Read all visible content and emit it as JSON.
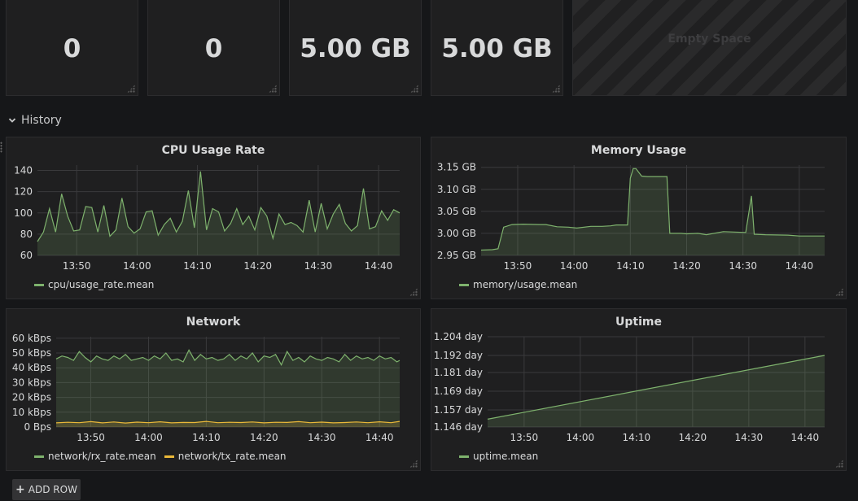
{
  "stats": [
    {
      "value": "0"
    },
    {
      "value": "0"
    },
    {
      "value": "5.00 GB"
    },
    {
      "value": "5.00 GB"
    }
  ],
  "empty_space": {
    "text": "Empty Space"
  },
  "row": {
    "title": "History"
  },
  "add_row": {
    "label": "ADD ROW"
  },
  "colors": {
    "green": "#7eb26d",
    "yellow": "#eab839"
  },
  "chart_data": [
    {
      "type": "line",
      "title": "CPU Usage Rate",
      "y_ticks": [
        "60",
        "80",
        "100",
        "120",
        "140"
      ],
      "ylim": [
        60,
        145
      ],
      "x_ticks": [
        "13:50",
        "14:00",
        "14:10",
        "14:20",
        "14:30",
        "14:40"
      ],
      "x_tick_minutes": [
        830,
        840,
        850,
        860,
        870,
        880
      ],
      "xlim": [
        823.5,
        883.5
      ],
      "series": [
        {
          "name": "cpu/usage_rate.mean",
          "color": "#7eb26d",
          "x": [
            823.5,
            824.5,
            825.5,
            826.5,
            827.5,
            828.5,
            829.5,
            830.5,
            831.5,
            832.5,
            833.5,
            834.5,
            835.5,
            836.5,
            837.5,
            838.5,
            839.5,
            840.5,
            841.5,
            842.5,
            843.5,
            844.5,
            845.5,
            846.5,
            847.5,
            848.5,
            849.5,
            850.5,
            851.5,
            852.5,
            853.5,
            854.5,
            855.5,
            856.5,
            857.5,
            858.5,
            859.5,
            860.5,
            861.5,
            862.5,
            863.5,
            864.5,
            865.5,
            866.5,
            867.5,
            868.5,
            869.5,
            870.5,
            871.5,
            872.5,
            873.5,
            874.5,
            875.5,
            876.5,
            877.5,
            878.5,
            879.5,
            880.5,
            881.5,
            882.5,
            883.5
          ],
          "y": [
            73,
            82,
            104,
            82,
            118,
            97,
            83,
            84,
            106,
            105,
            82,
            107,
            78,
            84,
            114,
            87,
            81,
            85,
            101,
            102,
            79,
            89,
            95,
            82,
            92,
            121,
            86,
            139,
            84,
            104,
            101,
            83,
            90,
            104,
            89,
            97,
            84,
            105,
            97,
            76,
            99,
            89,
            91,
            88,
            82,
            112,
            82,
            109,
            85,
            99,
            108,
            90,
            83,
            88,
            123,
            85,
            87,
            102,
            93,
            103,
            100
          ]
        }
      ]
    },
    {
      "type": "line",
      "title": "Memory Usage",
      "y_ticks": [
        "2.95 GB",
        "3.00 GB",
        "3.05 GB",
        "3.10 GB",
        "3.15 GB"
      ],
      "y_tick_values": [
        2.95,
        3.0,
        3.05,
        3.1,
        3.15
      ],
      "ylim": [
        2.95,
        3.155
      ],
      "x_ticks": [
        "13:50",
        "14:00",
        "14:10",
        "14:20",
        "14:30",
        "14:40"
      ],
      "x_tick_minutes": [
        830,
        840,
        850,
        860,
        870,
        880
      ],
      "xlim": [
        823.5,
        884.5
      ],
      "series": [
        {
          "name": "memory/usage.mean",
          "color": "#7eb26d",
          "x": [
            823.5,
            825.5,
            826.5,
            827.5,
            829,
            831,
            834,
            835,
            837,
            839,
            840.5,
            843,
            845,
            846.5,
            847.5,
            849.5,
            850,
            850.5,
            851,
            852,
            853,
            856.5,
            857,
            859,
            860,
            862,
            863.5,
            866.5,
            868.5,
            870.5,
            871.5,
            872,
            874,
            878,
            880,
            884.5
          ],
          "y": [
            2.962,
            2.963,
            2.965,
            3.014,
            3.02,
            3.021,
            3.02,
            3.02,
            3.015,
            3.014,
            3.012,
            3.016,
            3.016,
            3.017,
            3.019,
            3.019,
            3.125,
            3.147,
            3.147,
            3.13,
            3.129,
            3.129,
            3.0,
            3.0,
            2.999,
            3.0,
            2.997,
            3.004,
            3.003,
            3.002,
            3.085,
            2.998,
            2.997,
            2.996,
            2.994,
            2.994
          ]
        }
      ]
    },
    {
      "type": "line",
      "title": "Network",
      "y_ticks": [
        "0 Bps",
        "10 kBps",
        "20 kBps",
        "30 kBps",
        "40 kBps",
        "50 kBps",
        "60 kBps"
      ],
      "y_tick_values": [
        0,
        10,
        20,
        30,
        40,
        50,
        60
      ],
      "ylim": [
        0,
        61
      ],
      "x_ticks": [
        "13:50",
        "14:00",
        "14:10",
        "14:20",
        "14:30",
        "14:40"
      ],
      "x_tick_minutes": [
        830,
        840,
        850,
        860,
        870,
        880
      ],
      "xlim": [
        824,
        883.5
      ],
      "series": [
        {
          "name": "network/rx_rate.mean",
          "color": "#7eb26d",
          "x": [
            824,
            825,
            826,
            827,
            828,
            829,
            830,
            831,
            832,
            833,
            834,
            835,
            836,
            837,
            838,
            839,
            840,
            841,
            842,
            843,
            844,
            845,
            846,
            847,
            848,
            849,
            850,
            851,
            852,
            853,
            854,
            855,
            856,
            857,
            858,
            859,
            860,
            861,
            862,
            863,
            864,
            865,
            866,
            867,
            868,
            869,
            870,
            871,
            872,
            873,
            874,
            875,
            876,
            877,
            878,
            879,
            880,
            881,
            882,
            883,
            883.5
          ],
          "y": [
            46,
            48,
            47,
            45,
            51,
            47,
            44,
            48,
            46,
            45,
            48,
            46,
            49,
            45,
            46,
            47,
            45,
            48,
            46,
            50,
            45,
            46,
            44,
            52,
            45,
            49,
            46,
            47,
            45,
            46,
            49,
            45,
            48,
            46,
            50,
            44,
            48,
            47,
            49,
            42,
            51,
            45,
            47,
            44,
            48,
            46,
            45,
            47,
            46,
            44,
            49,
            45,
            48,
            46,
            47,
            45,
            48,
            46,
            47,
            44,
            45
          ]
        },
        {
          "name": "network/tx_rate.mean",
          "color": "#eab839",
          "x": [
            824,
            826,
            828,
            830,
            832,
            834,
            836,
            838,
            840,
            842,
            844,
            846,
            848,
            850,
            852,
            854,
            856,
            858,
            860,
            862,
            864,
            866,
            868,
            870,
            872,
            874,
            876,
            878,
            880,
            882,
            883.5
          ],
          "y": [
            2.8,
            3.2,
            2.9,
            3.6,
            2.8,
            3.4,
            2.7,
            3.3,
            2.9,
            3.5,
            2.8,
            3.1,
            3.0,
            3.8,
            2.9,
            3.2,
            3.0,
            3.4,
            2.8,
            3.2,
            3.1,
            3.6,
            2.9,
            3.3,
            2.8,
            3.0,
            3.4,
            2.9,
            3.5,
            2.9,
            3.8
          ]
        }
      ]
    },
    {
      "type": "line",
      "title": "Uptime",
      "y_ticks": [
        "1.146 day",
        "1.157 day",
        "1.169 day",
        "1.181 day",
        "1.192 day",
        "1.204 day"
      ],
      "y_tick_values": [
        1.146,
        1.157,
        1.169,
        1.181,
        1.192,
        1.204
      ],
      "ylim": [
        1.146,
        1.204
      ],
      "x_ticks": [
        "13:50",
        "14:00",
        "14:10",
        "14:20",
        "14:30",
        "14:40"
      ],
      "x_tick_minutes": [
        830,
        840,
        850,
        860,
        870,
        880
      ],
      "xlim": [
        823.5,
        883.5
      ],
      "series": [
        {
          "name": "uptime.mean",
          "color": "#7eb26d",
          "x": [
            823.5,
            883.5
          ],
          "y": [
            1.151,
            1.192
          ]
        }
      ]
    }
  ]
}
